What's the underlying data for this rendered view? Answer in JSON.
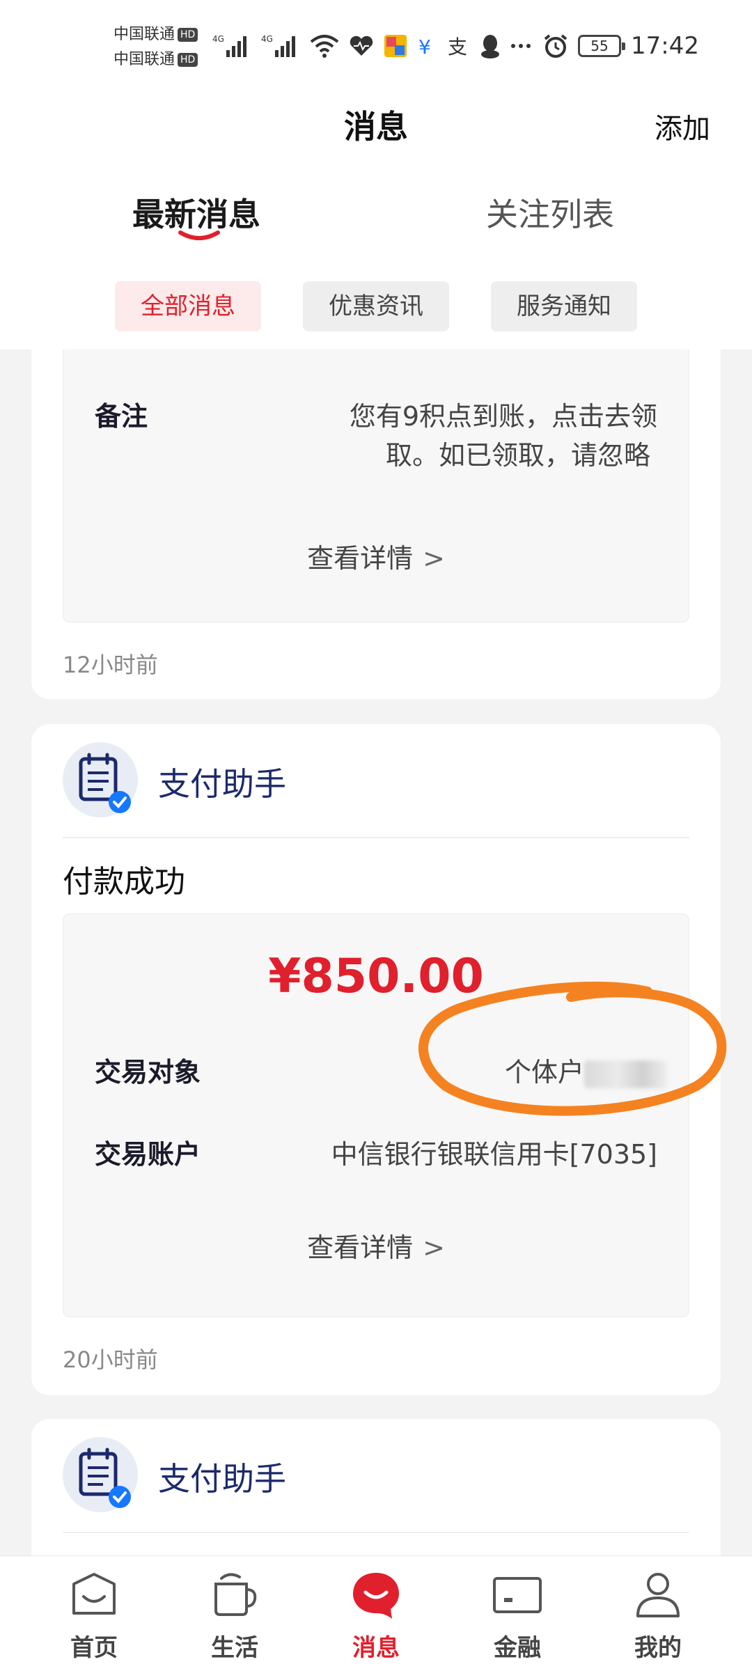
{
  "status_bar": {
    "carrier_1": "中国联通",
    "carrier_2": "中国联通",
    "hd_badge": "HD",
    "network_1": "4G",
    "network_2": "4G",
    "battery": "55",
    "time": "17:42",
    "icons": [
      "signal-icon",
      "signal-icon",
      "wifi-icon",
      "health-icon",
      "app-icon",
      "app-icon",
      "alipay-icon",
      "qq-icon",
      "more-icon",
      "alarm-icon",
      "battery-icon"
    ]
  },
  "header": {
    "title": "消息",
    "add_label": "添加"
  },
  "tabs": {
    "latest": "最新消息",
    "following": "关注列表"
  },
  "filters": [
    "全部消息",
    "优惠资讯",
    "服务通知"
  ],
  "card1": {
    "note_label": "备注",
    "note_value_line1": "您有9积点到账，点击去领",
    "note_value_line2": "取。如已领取，请忽略",
    "view_details": "查看详情",
    "time": "12小时前"
  },
  "card2": {
    "sender": "支付助手",
    "title": "付款成功",
    "amount": "¥850.00",
    "counterparty_label": "交易对象",
    "counterparty_value": "个体户",
    "account_label": "交易账户",
    "account_value": "中信银行银联信用卡[7035]",
    "view_details": "查看详情",
    "time": "20小时前"
  },
  "card3": {
    "sender": "支付助手"
  },
  "bottom_nav": [
    {
      "label": "首页",
      "icon": "home-icon"
    },
    {
      "label": "生活",
      "icon": "cup-icon"
    },
    {
      "label": "消息",
      "icon": "message-icon"
    },
    {
      "label": "金融",
      "icon": "card-icon"
    },
    {
      "label": "我的",
      "icon": "profile-icon"
    }
  ],
  "colors": {
    "accent": "#e0202c",
    "sender_name": "#1c2a6b",
    "verified_badge": "#1677ff",
    "annotation": "#f58220"
  }
}
